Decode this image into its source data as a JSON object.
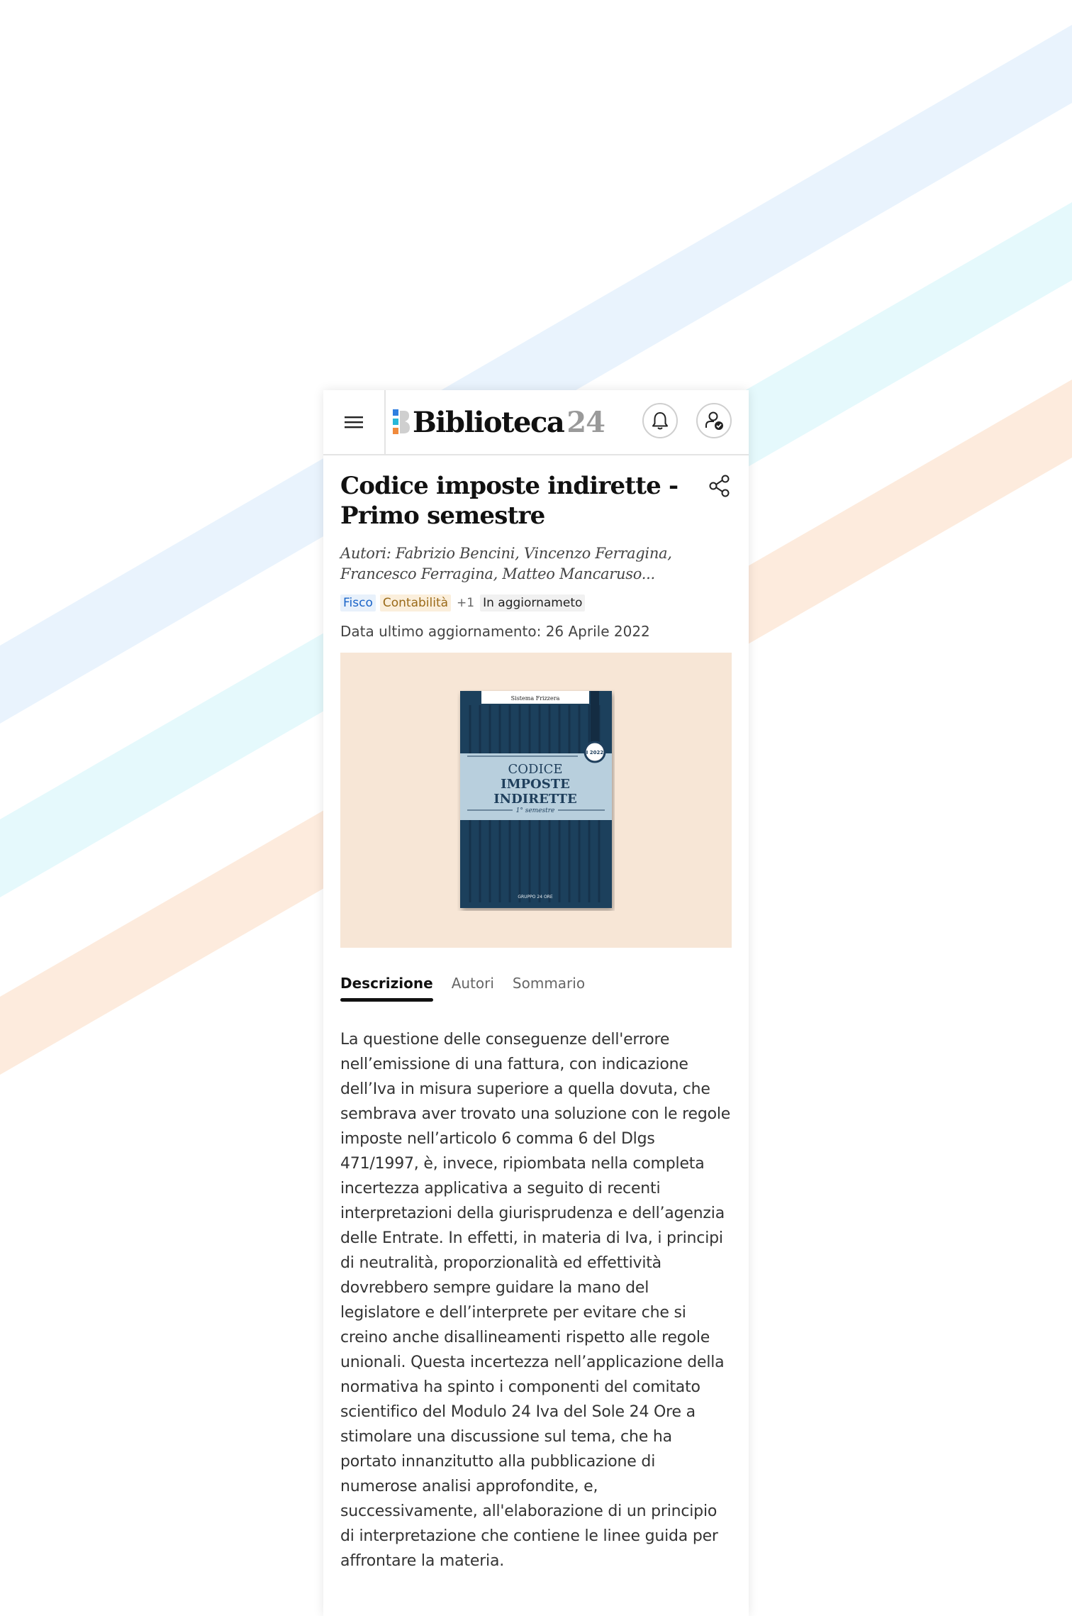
{
  "header": {
    "logo_text": "Biblioteca",
    "logo_number": "24"
  },
  "book": {
    "title": "Codice imposte indirette - Primo semestre",
    "authors": "Autori: Fabrizio Bencini, Vincenzo Ferragina, Francesco Ferragina, Matteo Mancaruso...",
    "tags": [
      "Fisco",
      "Contabilità",
      "+1"
    ],
    "status": "In aggiornameto",
    "last_update": "Data ultimo aggiornamento: 26 Aprile 2022",
    "cover": {
      "brand": "Sistema Frizzera",
      "line1": "CODICE",
      "line2": "IMPOSTE",
      "line3": "INDIRETTE",
      "subtitle": "1° semestre",
      "year_badge": "I 2022",
      "publisher": "GRUPPO 24 ORE"
    }
  },
  "tabs": [
    "Descrizione",
    "Autori",
    "Sommario"
  ],
  "description": "La questione delle conseguenze dell'errore nell’emissione di una fattura, con indicazione dell’Iva in misura superiore a quella dovuta, che sembrava aver trovato una soluzione con le regole imposte nell’articolo 6 comma 6 del Dlgs 471/1997, è, invece, ripiombata nella completa incertezza applicativa a seguito di recenti interpretazioni della giurisprudenza e dell’agenzia delle Entrate. In effetti, in materia di Iva, i principi di neutralità, proporzionalità ed effettività dovrebbero sempre guidare la mano del legislatore e dell’interprete per evitare che si creino anche disallineamenti rispetto alle regole unionali. Questa incertezza nell’applicazione della normativa ha spinto i componenti del comitato scientifico del Modulo 24 Iva del Sole 24 Ore a stimolare una discussione sul tema, che ha portato innanzitutto alla pubblicazione di numerose analisi approfondite, e, successivamente, all'elaborazione di un principio di interpretazione che contiene le linee guida per affrontare la materia.",
  "colors": {
    "stripe_blue": "#e9f3fd",
    "stripe_cyan": "#e5f9fc",
    "stripe_peach": "#fdebdd",
    "cover_bg": "#f7e6d6",
    "book_navy": "#1f3f5c"
  }
}
